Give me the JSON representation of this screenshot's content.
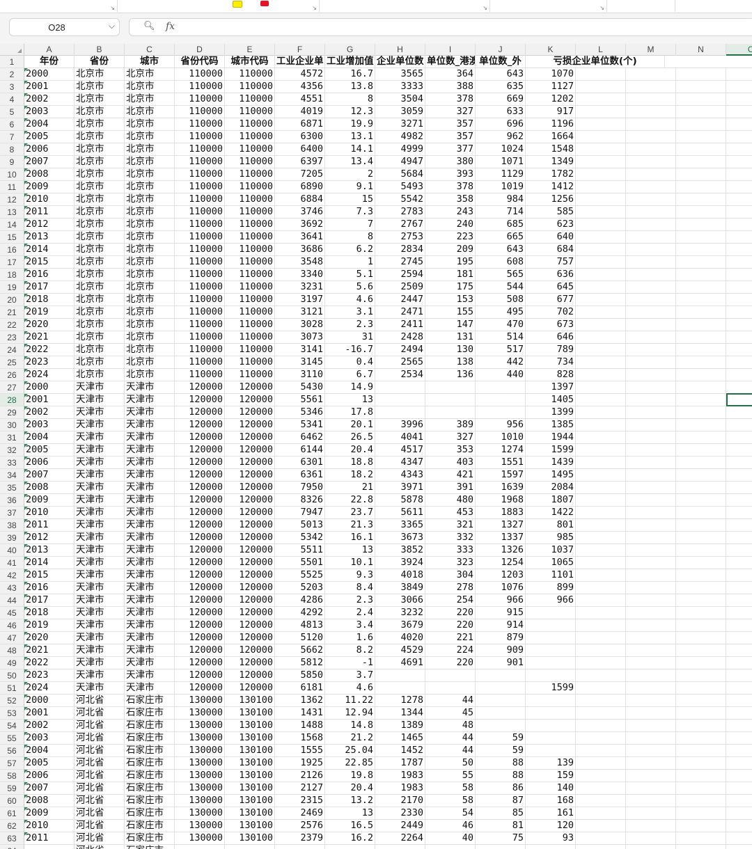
{
  "namebox": {
    "value": "O28"
  },
  "formula": {
    "value": ""
  },
  "columns": [
    "A",
    "B",
    "C",
    "D",
    "E",
    "F",
    "G",
    "H",
    "I",
    "J",
    "K",
    "L",
    "M",
    "N",
    "O"
  ],
  "active_column": "O",
  "active_row": 28,
  "header_row": [
    "年份",
    "省份",
    "城市",
    "省份代码",
    "城市代码",
    "工业企业单",
    "工业增加值",
    "企业单位数",
    "单位数_港澳",
    "单位数_外",
    "亏损企业单位数(个)"
  ],
  "rows": [
    [
      "2000",
      "北京市",
      "北京市",
      "110000",
      "110000",
      "4572",
      "16.7",
      "3565",
      "364",
      "643",
      "1070"
    ],
    [
      "2001",
      "北京市",
      "北京市",
      "110000",
      "110000",
      "4356",
      "13.8",
      "3333",
      "388",
      "635",
      "1127"
    ],
    [
      "2002",
      "北京市",
      "北京市",
      "110000",
      "110000",
      "4551",
      "8",
      "3504",
      "378",
      "669",
      "1202"
    ],
    [
      "2003",
      "北京市",
      "北京市",
      "110000",
      "110000",
      "4019",
      "12.3",
      "3059",
      "327",
      "633",
      "917"
    ],
    [
      "2004",
      "北京市",
      "北京市",
      "110000",
      "110000",
      "6871",
      "19.9",
      "3271",
      "357",
      "696",
      "1196"
    ],
    [
      "2005",
      "北京市",
      "北京市",
      "110000",
      "110000",
      "6300",
      "13.1",
      "4982",
      "357",
      "962",
      "1664"
    ],
    [
      "2006",
      "北京市",
      "北京市",
      "110000",
      "110000",
      "6400",
      "14.1",
      "4999",
      "377",
      "1024",
      "1548"
    ],
    [
      "2007",
      "北京市",
      "北京市",
      "110000",
      "110000",
      "6397",
      "13.4",
      "4947",
      "380",
      "1071",
      "1349"
    ],
    [
      "2008",
      "北京市",
      "北京市",
      "110000",
      "110000",
      "7205",
      "2",
      "5684",
      "393",
      "1129",
      "1782"
    ],
    [
      "2009",
      "北京市",
      "北京市",
      "110000",
      "110000",
      "6890",
      "9.1",
      "5493",
      "378",
      "1019",
      "1412"
    ],
    [
      "2010",
      "北京市",
      "北京市",
      "110000",
      "110000",
      "6884",
      "15",
      "5542",
      "358",
      "984",
      "1256"
    ],
    [
      "2011",
      "北京市",
      "北京市",
      "110000",
      "110000",
      "3746",
      "7.3",
      "2783",
      "243",
      "714",
      "585"
    ],
    [
      "2012",
      "北京市",
      "北京市",
      "110000",
      "110000",
      "3692",
      "7",
      "2767",
      "240",
      "685",
      "623"
    ],
    [
      "2013",
      "北京市",
      "北京市",
      "110000",
      "110000",
      "3641",
      "8",
      "2753",
      "223",
      "665",
      "640"
    ],
    [
      "2014",
      "北京市",
      "北京市",
      "110000",
      "110000",
      "3686",
      "6.2",
      "2834",
      "209",
      "643",
      "684"
    ],
    [
      "2015",
      "北京市",
      "北京市",
      "110000",
      "110000",
      "3548",
      "1",
      "2745",
      "195",
      "608",
      "757"
    ],
    [
      "2016",
      "北京市",
      "北京市",
      "110000",
      "110000",
      "3340",
      "5.1",
      "2594",
      "181",
      "565",
      "636"
    ],
    [
      "2017",
      "北京市",
      "北京市",
      "110000",
      "110000",
      "3231",
      "5.6",
      "2509",
      "175",
      "544",
      "645"
    ],
    [
      "2018",
      "北京市",
      "北京市",
      "110000",
      "110000",
      "3197",
      "4.6",
      "2447",
      "153",
      "508",
      "677"
    ],
    [
      "2019",
      "北京市",
      "北京市",
      "110000",
      "110000",
      "3121",
      "3.1",
      "2471",
      "155",
      "495",
      "702"
    ],
    [
      "2020",
      "北京市",
      "北京市",
      "110000",
      "110000",
      "3028",
      "2.3",
      "2411",
      "147",
      "470",
      "673"
    ],
    [
      "2021",
      "北京市",
      "北京市",
      "110000",
      "110000",
      "3073",
      "31",
      "2428",
      "131",
      "514",
      "646"
    ],
    [
      "2022",
      "北京市",
      "北京市",
      "110000",
      "110000",
      "3141",
      "-16.7",
      "2494",
      "130",
      "517",
      "789"
    ],
    [
      "2023",
      "北京市",
      "北京市",
      "110000",
      "110000",
      "3145",
      "0.4",
      "2565",
      "138",
      "442",
      "734"
    ],
    [
      "2024",
      "北京市",
      "北京市",
      "110000",
      "110000",
      "3110",
      "6.7",
      "2534",
      "136",
      "440",
      "828"
    ],
    [
      "2000",
      "天津市",
      "天津市",
      "120000",
      "120000",
      "5430",
      "14.9",
      "",
      "",
      "",
      "1397"
    ],
    [
      "2001",
      "天津市",
      "天津市",
      "120000",
      "120000",
      "5561",
      "13",
      "",
      "",
      "",
      "1405"
    ],
    [
      "2002",
      "天津市",
      "天津市",
      "120000",
      "120000",
      "5346",
      "17.8",
      "",
      "",
      "",
      "1399"
    ],
    [
      "2003",
      "天津市",
      "天津市",
      "120000",
      "120000",
      "5341",
      "20.1",
      "3996",
      "389",
      "956",
      "1385"
    ],
    [
      "2004",
      "天津市",
      "天津市",
      "120000",
      "120000",
      "6462",
      "26.5",
      "4041",
      "327",
      "1010",
      "1944"
    ],
    [
      "2005",
      "天津市",
      "天津市",
      "120000",
      "120000",
      "6144",
      "20.4",
      "4517",
      "353",
      "1274",
      "1599"
    ],
    [
      "2006",
      "天津市",
      "天津市",
      "120000",
      "120000",
      "6301",
      "18.8",
      "4347",
      "403",
      "1551",
      "1439"
    ],
    [
      "2007",
      "天津市",
      "天津市",
      "120000",
      "120000",
      "6361",
      "18.2",
      "4343",
      "421",
      "1597",
      "1495"
    ],
    [
      "2008",
      "天津市",
      "天津市",
      "120000",
      "120000",
      "7950",
      "21",
      "3971",
      "391",
      "1639",
      "2084"
    ],
    [
      "2009",
      "天津市",
      "天津市",
      "120000",
      "120000",
      "8326",
      "22.8",
      "5878",
      "480",
      "1968",
      "1807"
    ],
    [
      "2010",
      "天津市",
      "天津市",
      "120000",
      "120000",
      "7947",
      "23.7",
      "5611",
      "453",
      "1883",
      "1422"
    ],
    [
      "2011",
      "天津市",
      "天津市",
      "120000",
      "120000",
      "5013",
      "21.3",
      "3365",
      "321",
      "1327",
      "801"
    ],
    [
      "2012",
      "天津市",
      "天津市",
      "120000",
      "120000",
      "5342",
      "16.1",
      "3673",
      "332",
      "1337",
      "985"
    ],
    [
      "2013",
      "天津市",
      "天津市",
      "120000",
      "120000",
      "5511",
      "13",
      "3852",
      "333",
      "1326",
      "1037"
    ],
    [
      "2014",
      "天津市",
      "天津市",
      "120000",
      "120000",
      "5501",
      "10.1",
      "3924",
      "323",
      "1254",
      "1065"
    ],
    [
      "2015",
      "天津市",
      "天津市",
      "120000",
      "120000",
      "5525",
      "9.3",
      "4018",
      "304",
      "1203",
      "1101"
    ],
    [
      "2016",
      "天津市",
      "天津市",
      "120000",
      "120000",
      "5203",
      "8.4",
      "3849",
      "278",
      "1076",
      "899"
    ],
    [
      "2017",
      "天津市",
      "天津市",
      "120000",
      "120000",
      "4286",
      "2.3",
      "3066",
      "254",
      "966",
      "966"
    ],
    [
      "2018",
      "天津市",
      "天津市",
      "120000",
      "120000",
      "4292",
      "2.4",
      "3232",
      "220",
      "915",
      ""
    ],
    [
      "2019",
      "天津市",
      "天津市",
      "120000",
      "120000",
      "4813",
      "3.4",
      "3679",
      "220",
      "914",
      ""
    ],
    [
      "2020",
      "天津市",
      "天津市",
      "120000",
      "120000",
      "5120",
      "1.6",
      "4020",
      "221",
      "879",
      ""
    ],
    [
      "2021",
      "天津市",
      "天津市",
      "120000",
      "120000",
      "5662",
      "8.2",
      "4529",
      "224",
      "909",
      ""
    ],
    [
      "2022",
      "天津市",
      "天津市",
      "120000",
      "120000",
      "5812",
      "-1",
      "4691",
      "220",
      "901",
      ""
    ],
    [
      "2023",
      "天津市",
      "天津市",
      "120000",
      "120000",
      "5850",
      "3.7",
      "",
      "",
      "",
      ""
    ],
    [
      "2024",
      "天津市",
      "天津市",
      "120000",
      "120000",
      "6181",
      "4.6",
      "",
      "",
      "",
      "1599"
    ],
    [
      "2000",
      "河北省",
      "石家庄市",
      "130000",
      "130100",
      "1362",
      "11.22",
      "1278",
      "44",
      "",
      ""
    ],
    [
      "2001",
      "河北省",
      "石家庄市",
      "130000",
      "130100",
      "1431",
      "12.94",
      "1344",
      "45",
      "",
      ""
    ],
    [
      "2002",
      "河北省",
      "石家庄市",
      "130000",
      "130100",
      "1488",
      "14.8",
      "1389",
      "48",
      "",
      ""
    ],
    [
      "2003",
      "河北省",
      "石家庄市",
      "130000",
      "130100",
      "1568",
      "21.2",
      "1465",
      "44",
      "59",
      ""
    ],
    [
      "2004",
      "河北省",
      "石家庄市",
      "130000",
      "130100",
      "1555",
      "25.04",
      "1452",
      "44",
      "59",
      ""
    ],
    [
      "2005",
      "河北省",
      "石家庄市",
      "130000",
      "130100",
      "1925",
      "22.85",
      "1787",
      "50",
      "88",
      "139"
    ],
    [
      "2006",
      "河北省",
      "石家庄市",
      "130000",
      "130100",
      "2126",
      "19.8",
      "1983",
      "55",
      "88",
      "159"
    ],
    [
      "2007",
      "河北省",
      "石家庄市",
      "130000",
      "130100",
      "2127",
      "20.4",
      "1983",
      "58",
      "86",
      "140"
    ],
    [
      "2008",
      "河北省",
      "石家庄市",
      "130000",
      "130100",
      "2315",
      "13.2",
      "2170",
      "58",
      "87",
      "168"
    ],
    [
      "2009",
      "河北省",
      "石家庄市",
      "130000",
      "130100",
      "2469",
      "13",
      "2330",
      "54",
      "85",
      "161"
    ],
    [
      "2010",
      "河北省",
      "石家庄市",
      "130000",
      "130100",
      "2576",
      "16.5",
      "2449",
      "46",
      "81",
      "120"
    ],
    [
      "2011",
      "河北省",
      "石家庄市",
      "130000",
      "130100",
      "2379",
      "16.2",
      "2264",
      "40",
      "75",
      "93"
    ],
    [
      "",
      "河北省",
      "石家庄市",
      "",
      "",
      "",
      "",
      "",
      "",
      "",
      ""
    ]
  ]
}
